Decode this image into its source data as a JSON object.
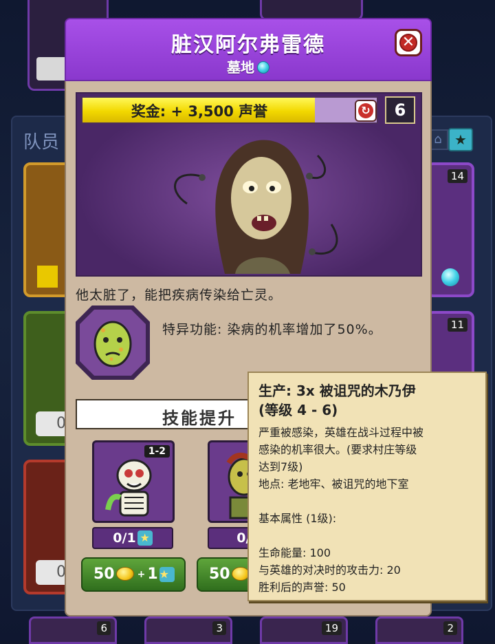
{
  "dialog": {
    "title": "脏汉阿尔弗雷德",
    "subtitle": "墓地",
    "close_icon": "close-icon",
    "bounty_label": "奖金: + 3,500 声誉",
    "bounty_fill_percent": 79,
    "count": "6",
    "description": "他太脏了，能把疾病传染给亡灵。",
    "ability": "特异功能: 染病的机率增加了50%。",
    "skills_label": "技能提升",
    "skills": [
      {
        "badge": "1-2",
        "progress": "0/1",
        "cost": "50",
        "extra": "1"
      },
      {
        "badge": "",
        "progress": "0/1",
        "cost": "50",
        "extra": ""
      }
    ]
  },
  "tooltip": {
    "title": "生产: 3x 被诅咒的木乃伊",
    "subtitle": "(等级 4 - 6)",
    "desc_line1": "严重被感染，英雄在战斗过程中被",
    "desc_line2": "感染的机率很大。(要求村庄等级",
    "desc_line3": "达到7级)",
    "location": "地点: 老地牢、被诅咒的地下室",
    "attributes_header": "基本属性 (1级):",
    "hp": "生命能量: 100",
    "attack": "与英雄的对决时的攻击力: 20",
    "reputation": "胜利后的声誉: 50"
  },
  "background": {
    "section_title": "队员",
    "right_levels": [
      "14",
      "11"
    ],
    "left_plate_texts": [
      "0",
      "0"
    ],
    "bottom_levels": [
      "6",
      "3",
      "19",
      "2"
    ]
  },
  "colors": {
    "header_purple": "#9a45dc",
    "body_tan": "#cdb9a2",
    "bounty_yellow": "#f2d800",
    "tooltip_bg": "#f1e2b6",
    "button_green": "#3f8a26"
  }
}
